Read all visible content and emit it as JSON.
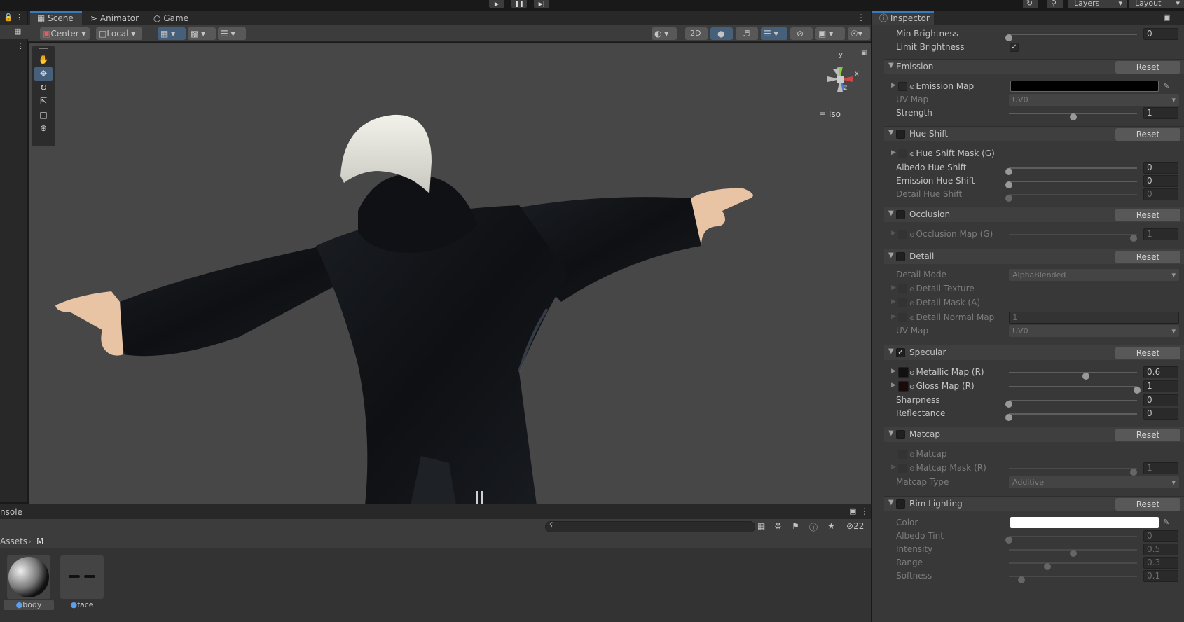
{
  "toolbar": {
    "layers_label": "Layers",
    "layout_label": "Layout"
  },
  "scene_tabs": {
    "scene": "Scene",
    "animator": "Animator",
    "game": "Game"
  },
  "scene_toolbar": {
    "pivot": "Center",
    "space": "Local",
    "two_d": "2D"
  },
  "viewport": {
    "projection_label": "Iso",
    "gizmo_y": "y",
    "gizmo_x": "x",
    "gizmo_z": "z",
    "background_color": "#474747"
  },
  "bottom_panel": {
    "tab_label": "nsole",
    "hidden_count": "22",
    "breadcrumb_root": "Assets",
    "breadcrumb_child": "M",
    "assets": [
      {
        "name": "body"
      },
      {
        "name": "face"
      }
    ]
  },
  "inspector": {
    "tab_label": "Inspector",
    "min_brightness": {
      "label": "Min Brightness",
      "value": "0",
      "fraction": 0.0
    },
    "limit_brightness": {
      "label": "Limit Brightness",
      "checked": true
    },
    "emission": {
      "title": "Emission",
      "reset": "Reset",
      "map_label": "Emission Map",
      "map_color": "#000000",
      "uv_label": "UV Map",
      "uv_value": "UV0",
      "strength_label": "Strength",
      "strength_value": "1",
      "strength_fraction": 0.5
    },
    "hue_shift": {
      "title": "Hue Shift",
      "reset": "Reset",
      "mask_label": "Hue Shift Mask (G)",
      "albedo_label": "Albedo Hue Shift",
      "albedo_value": "0",
      "emission_label": "Emission Hue Shift",
      "emission_value": "0",
      "detail_label": "Detail Hue Shift",
      "detail_value": "0"
    },
    "occlusion": {
      "title": "Occlusion",
      "reset": "Reset",
      "map_label": "Occlusion Map (G)",
      "map_value": "1"
    },
    "detail": {
      "title": "Detail",
      "reset": "Reset",
      "mode_label": "Detail Mode",
      "mode_value": "AlphaBlended",
      "texture_label": "Detail Texture",
      "mask_label": "Detail Mask (A)",
      "normal_label": "Detail Normal Map",
      "normal_value": "1",
      "uv_label": "UV Map",
      "uv_value": "UV0"
    },
    "specular": {
      "title": "Specular",
      "reset": "Reset",
      "enabled": true,
      "metallic_label": "Metallic Map (R)",
      "metallic_value": "0.6",
      "metallic_fraction": 0.6,
      "gloss_label": "Gloss Map (R)",
      "gloss_value": "1",
      "gloss_fraction": 1.0,
      "sharpness_label": "Sharpness",
      "sharpness_value": "0",
      "reflectance_label": "Reflectance",
      "reflectance_value": "0"
    },
    "matcap": {
      "title": "Matcap",
      "reset": "Reset",
      "matcap_label": "Matcap",
      "mask_label": "Matcap Mask (R)",
      "mask_value": "1",
      "type_label": "Matcap Type",
      "type_value": "Additive"
    },
    "rim": {
      "title": "Rim Lighting",
      "reset": "Reset",
      "color_label": "Color",
      "color_value": "#ffffff",
      "albedo_tint_label": "Albedo Tint",
      "albedo_tint_value": "0",
      "intensity_label": "Intensity",
      "intensity_value": "0.5",
      "intensity_fraction": 0.5,
      "range_label": "Range",
      "range_value": "0.3",
      "range_fraction": 0.3,
      "softness_label": "Softness",
      "softness_value": "0.1",
      "softness_fraction": 0.1
    }
  }
}
